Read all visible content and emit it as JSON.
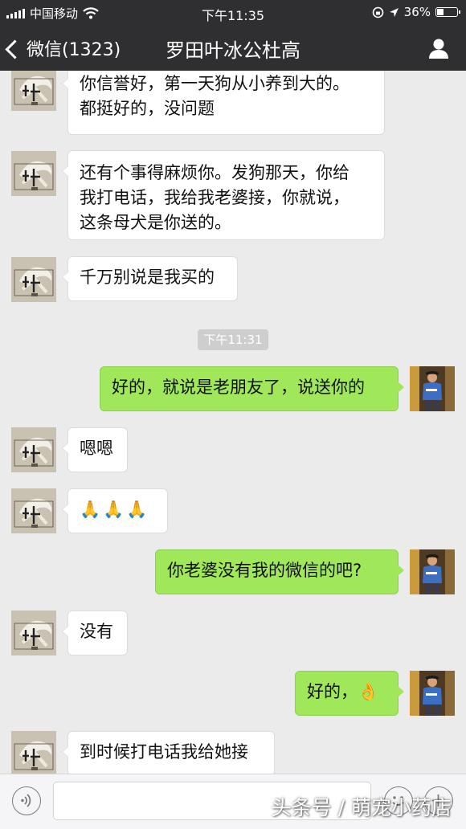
{
  "status_bar": {
    "carrier": "中国移动",
    "time": "下午11:35",
    "battery": "36%",
    "battery_level": 0.36
  },
  "nav": {
    "back_label": "微信(1323)",
    "title": "罗田叶冰公杜高"
  },
  "messages": [
    {
      "side": "in",
      "lines": [
        "你信誉好，第一天狗从小养到大的。",
        "都挺好的，没问题"
      ]
    },
    {
      "side": "in",
      "lines": [
        "还有个事得麻烦你。发狗那天，你给",
        "我打电话，我给我老婆接，你就说，",
        "这条母犬是你送的。"
      ]
    },
    {
      "side": "in",
      "text": "千万别说是我买的"
    },
    {
      "type": "time",
      "text": "下午11:31"
    },
    {
      "side": "out",
      "text": "好的，就说是老朋友了，说送你的"
    },
    {
      "side": "in",
      "text": "嗯嗯"
    },
    {
      "side": "in",
      "emoji": "🙏🙏🙏"
    },
    {
      "side": "out",
      "text": "你老婆没有我的微信的吧?"
    },
    {
      "side": "in",
      "text": "没有"
    },
    {
      "side": "out",
      "text": "好的，",
      "emoji": "👌"
    },
    {
      "side": "in",
      "text": "到时候打电话我给她接"
    }
  ],
  "watermark": "头条号 / 萌宠小药店",
  "icons": {
    "back": "chevron-left-icon",
    "profile": "person-icon",
    "voice": "voice-icon",
    "emoji": "emoji-icon",
    "plus": "plus-icon"
  }
}
